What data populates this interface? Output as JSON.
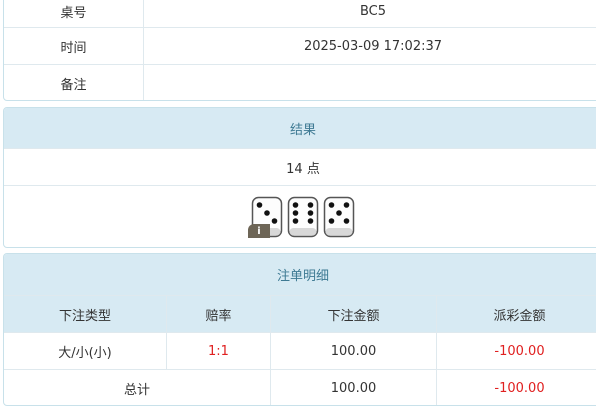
{
  "info": {
    "rows": [
      {
        "label": "桌号",
        "value": "BC5"
      },
      {
        "label": "时间",
        "value": "2025-03-09 17:02:37"
      },
      {
        "label": "备注",
        "value": ""
      }
    ]
  },
  "result": {
    "header": "结果",
    "points": "14 点",
    "dice": [
      3,
      6,
      5
    ],
    "info_badge": "i"
  },
  "bets": {
    "header": "注单明细",
    "columns": [
      "下注类型",
      "赔率",
      "下注金额",
      "派彩金额"
    ],
    "rows": [
      {
        "type": "大/小(小)",
        "odds": "1:1",
        "amount": "100.00",
        "payout": "-100.00"
      }
    ],
    "total": {
      "label": "总计",
      "amount": "100.00",
      "payout": "-100.00"
    }
  },
  "colors": {
    "header_bg": "#d7eaf3",
    "header_text": "#3e7a93",
    "negative": "#e02020"
  }
}
